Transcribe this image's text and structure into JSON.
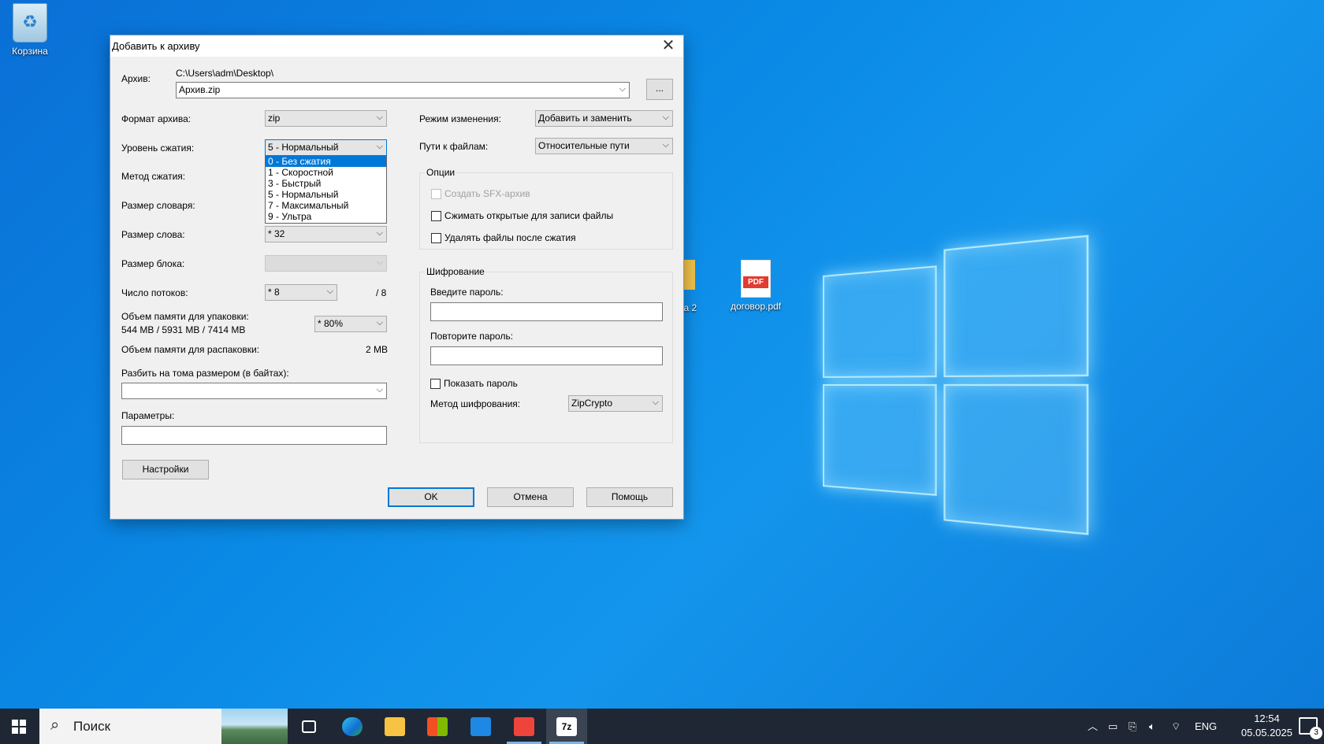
{
  "desktop": {
    "recycle_bin": "Корзина",
    "pdf_file": "договор.pdf",
    "pdf_badge": "PDF",
    "folder_partial": "ка 2"
  },
  "dialog": {
    "title": "Добавить к архиву",
    "close_glyph": "✕",
    "archive_label": "Архив:",
    "archive_path": "C:\\Users\\adm\\Desktop\\",
    "archive_name": "Архив.zip",
    "browse_label": "...",
    "left": {
      "format_label": "Формат архива:",
      "format_value": "zip",
      "level_label": "Уровень сжатия:",
      "level_value": "5 - Нормальный",
      "level_options": [
        "0 - Без сжатия",
        "1 - Скоростной",
        "3 - Быстрый",
        "5 - Нормальный",
        "7 - Максимальный",
        "9 - Ультра"
      ],
      "level_highlighted": "0 - Без сжатия",
      "method_label": "Метод сжатия:",
      "dict_label": "Размер словаря:",
      "word_label": "Размер слова:",
      "word_value": "* 32",
      "block_label": "Размер блока:",
      "threads_label": "Число потоков:",
      "threads_value": "* 8",
      "threads_max": "/ 8",
      "mem_pack_label": "Объем памяти для упаковки:",
      "mem_pack_detail": "544 MB / 5931 MB / 7414 MB",
      "mem_pack_value": "* 80%",
      "mem_unpack_label": "Объем памяти для распаковки:",
      "mem_unpack_value": "2 MB",
      "split_label": "Разбить на тома размером (в байтах):",
      "split_value": "",
      "params_label": "Параметры:",
      "params_value": "",
      "settings_button": "Настройки"
    },
    "right": {
      "update_label": "Режим изменения:",
      "update_value": "Добавить и заменить",
      "paths_label": "Пути к файлам:",
      "paths_value": "Относительные пути",
      "options_title": "Опции",
      "opt_sfx": "Создать SFX-архив",
      "opt_shared": "Сжимать открытые для записи файлы",
      "opt_delete": "Удалять файлы после сжатия",
      "encryption_title": "Шифрование",
      "password_label": "Введите пароль:",
      "password_repeat_label": "Повторите пароль:",
      "show_password": "Показать пароль",
      "enc_method_label": "Метод шифрования:",
      "enc_method_value": "ZipCrypto"
    },
    "buttons": {
      "ok": "OK",
      "cancel": "Отмена",
      "help": "Помощь"
    }
  },
  "taskbar": {
    "search_placeholder": "Поиск",
    "lang": "ENG",
    "time": "12:54",
    "date": "05.05.2025",
    "notifications": "3",
    "app_7z": "7z"
  }
}
